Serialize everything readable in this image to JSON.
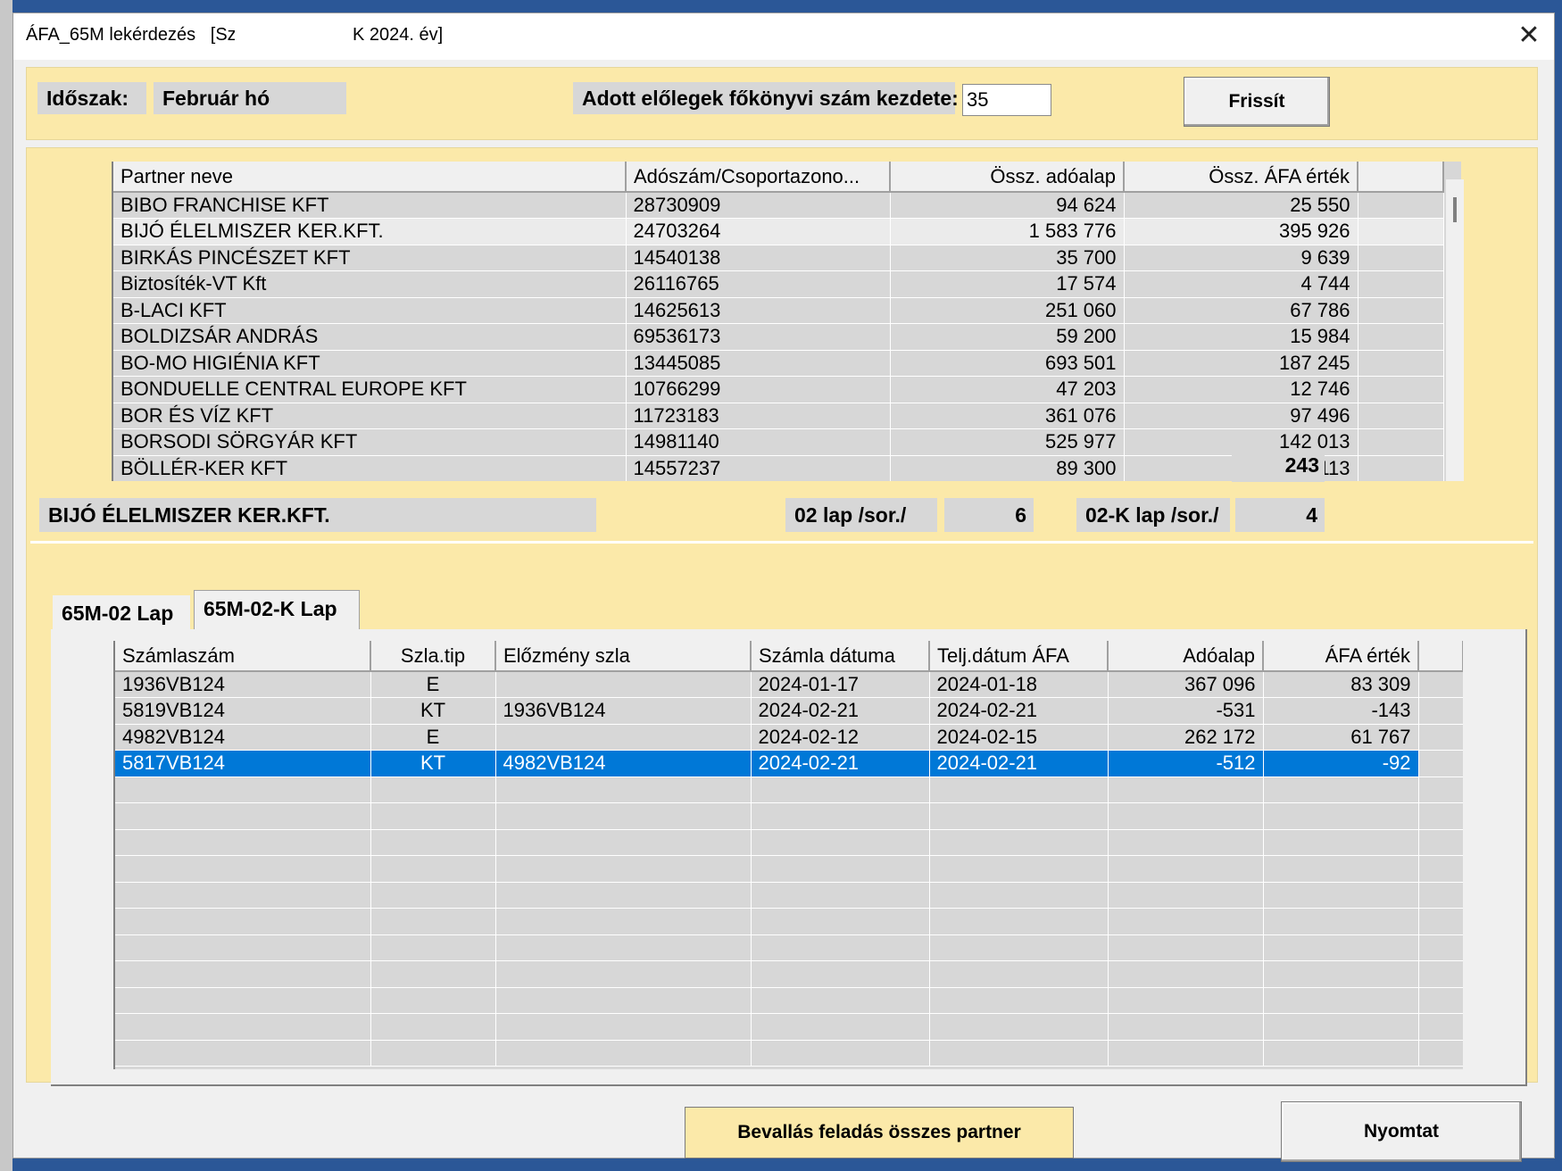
{
  "window": {
    "title": "ÁFA_65M lekérdezés   [Sz",
    "title_suffix": "K   2024. év]",
    "close_glyph": "✕"
  },
  "header": {
    "period_label": "Időszak:",
    "period_value": "Február hó",
    "account_label": "Adott előlegek főkönyvi szám kezdete:",
    "account_value": "35",
    "refresh_button": "Frissít"
  },
  "partners": {
    "columns": [
      "Partner neve",
      "Adószám/Csoportazono...",
      "Össz. adóalap",
      "Össz. ÁFA érték"
    ],
    "rows": [
      [
        "BIBO FRANCHISE KFT",
        "28730909",
        "94 624",
        "25 550"
      ],
      [
        "BIJÓ ÉLELMISZER KER.KFT.",
        "24703264",
        "1 583 776",
        "395 926"
      ],
      [
        "BIRKÁS PINCÉSZET KFT",
        "14540138",
        "35 700",
        "9 639"
      ],
      [
        "Biztosíték-VT Kft",
        "26116765",
        "17 574",
        "4 744"
      ],
      [
        "B-LACI KFT",
        "14625613",
        "251 060",
        "67 786"
      ],
      [
        "BOLDIZSÁR ANDRÁS",
        "69536173",
        "59 200",
        "15 984"
      ],
      [
        "BO-MO HIGIÉNIA KFT",
        "13445085",
        "693 501",
        "187 245"
      ],
      [
        "BONDUELLE CENTRAL EUROPE KFT",
        "10766299",
        "47 203",
        "12 746"
      ],
      [
        "BOR ÉS VÍZ KFT",
        "11723183",
        "361 076",
        "97 496"
      ],
      [
        "BORSODI SÖRGYÁR KFT",
        "14981140",
        "525 977",
        "142 013"
      ],
      [
        "BÖLLÉR-KER KFT",
        "14557237",
        "89 300",
        "24 113"
      ]
    ],
    "total_count": "243"
  },
  "detail": {
    "partner_name": "BIJÓ ÉLELMISZER KER.KFT.",
    "lap02_label": "02 lap /sor./",
    "lap02_value": "6",
    "lap02k_label": "02-K lap /sor./",
    "lap02k_value": "4"
  },
  "tabs": {
    "tab1": "65M-02 Lap",
    "tab2": "65M-02-K Lap"
  },
  "invoices": {
    "columns": [
      "Számlaszám",
      "Szla.tip",
      "Előzmény szla",
      "Számla dátuma",
      "Telj.dátum ÁFA",
      "Adóalap",
      "ÁFA érték"
    ],
    "rows": [
      [
        "1936VB124",
        "E",
        "",
        "2024-01-17",
        "2024-01-18",
        "367 096",
        "83 309"
      ],
      [
        "5819VB124",
        "KT",
        "1936VB124",
        "2024-02-21",
        "2024-02-21",
        "-531",
        "-143"
      ],
      [
        "4982VB124",
        "E",
        "",
        "2024-02-12",
        "2024-02-15",
        "262 172",
        "61 767"
      ],
      [
        "5817VB124",
        "KT",
        "4982VB124",
        "2024-02-21",
        "2024-02-21",
        "-512",
        "-92"
      ]
    ]
  },
  "footer": {
    "submit_all_button": "Bevallás feladás összes partner",
    "print_button": "Nyomtat"
  }
}
